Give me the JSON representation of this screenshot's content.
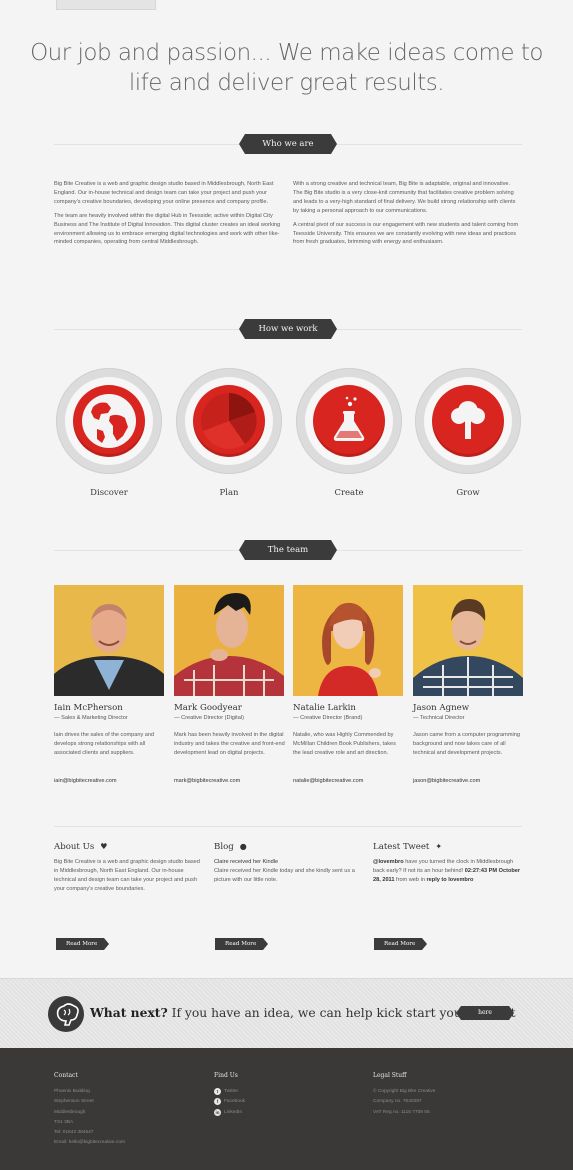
{
  "hero": {
    "line1": "Our job and passion... We make ideas come to",
    "line2": "life and deliver great results."
  },
  "sections": {
    "who_we_are": "Who we are",
    "how_we_work": "How we work",
    "the_team": "The team"
  },
  "who_we_are": {
    "left": [
      "Big Bite Creative is a web and graphic design studio based in Middlesbrough, North East England. Our in-house technical and design team can take your project and push your company's creative boundaries, developing your online presence and company profile.",
      "The team are heavily involved within the digital Hub in Teesside; active within Digital City Business and The Institute of Digital Innovation. This digital cluster creates an ideal working environment allowing us to embrace emerging digital technologies and work with other like-minded companies, operating from central Middlesbrough."
    ],
    "right": [
      "With a strong creative and technical team, Big Bite is adaptable, original and innovative. The Big Bite studio is a very close-knit community that facilitates creative problem solving and leads to a very-high standard of final delivery. We build strong relationship with clients by taking a personal approach to our communications.",
      "A central pivot of our success is our engagement with new students and talent coming from Teesside University. This ensures we are constantly evolving with new ideas and practices from fresh graduates, brimming with energy and enthusiasm."
    ]
  },
  "process": [
    {
      "label": "Discover",
      "icon": "globe-icon"
    },
    {
      "label": "Plan",
      "icon": "pie-chart-icon"
    },
    {
      "label": "Create",
      "icon": "flask-icon"
    },
    {
      "label": "Grow",
      "icon": "tree-icon"
    }
  ],
  "team": [
    {
      "name": "Iain McPherson",
      "role": "— Sales & Marketing Director",
      "bio": "Iain drives the sales of the company and develops strong relationships with all associated clients and suppliers.",
      "email": "iain@bigbitecreative.com"
    },
    {
      "name": "Mark Goodyear",
      "role": "— Creative Director (Digital)",
      "bio": "Mark has been heavily involved in the digital industry and takes the creative and front-end development lead on digital projects.",
      "email": "mark@bigbitecreative.com"
    },
    {
      "name": "Natalie Larkin",
      "role": "— Creative Director (Brand)",
      "bio": "Natalie, who was Highly Commended by McMillan Children Book Publishers, takes the lead creative role and art direction.",
      "email": "natalie@bigbitecreative.com"
    },
    {
      "name": "Jason Agnew",
      "role": "— Technical Director",
      "bio": "Jason came from a computer programming background and now takes care of all technical and development projects.",
      "email": "jason@bigbitecreative.com"
    }
  ],
  "columns": {
    "about": {
      "title": "About Us",
      "text": "Big Bite Creative is a web and graphic design studio based in Middlesbrough, North East England. Our in-house technical and design team can take your project and push your company's creative boundaries.",
      "button": "Read More"
    },
    "blog": {
      "title": "Blog",
      "post_title": "Claire received her Kindle",
      "text": "Claire received her Kindle today and she kindly sent us a picture with our little note.",
      "button": "Read More"
    },
    "tweet": {
      "title": "Latest Tweet",
      "handle": "@lovembro",
      "text": " have you turned the clock in Middlesbrough back early? If not its an hour behind! ",
      "time": "02:27:43 PM October 28, 2011",
      "from": " from web in ",
      "reply": "reply to lovembro",
      "button": "Read More"
    }
  },
  "cta": {
    "strong": "What next?",
    "text": " If you have an idea, we can help kick start your project",
    "button": "here"
  },
  "footer": {
    "contact": {
      "title": "Contact",
      "lines": [
        "Phoenix Building",
        "Stephenson Street",
        "Middlesbrough",
        "TS1 3BA",
        "Tel: 01642 384547",
        "Email: hello@bigbitecreative.com"
      ]
    },
    "find_us": {
      "title": "Find Us",
      "links": [
        {
          "label": "Twitter",
          "icon": "twitter-icon",
          "glyph": "t"
        },
        {
          "label": "Facebook",
          "icon": "facebook-icon",
          "glyph": "f"
        },
        {
          "label": "LinkedIn",
          "icon": "linkedin-icon",
          "glyph": "in"
        }
      ]
    },
    "legal": {
      "title": "Legal Stuff",
      "lines": [
        "© Copyright Big Bite Creative",
        "Company no. 7640397",
        "VAT Reg no. 1115 7708 05"
      ]
    }
  },
  "colors": {
    "accent_red": "#d8251f",
    "dark": "#3b3b3b",
    "footer_bg": "#3b3838",
    "page_bg": "#f4f4f4"
  }
}
